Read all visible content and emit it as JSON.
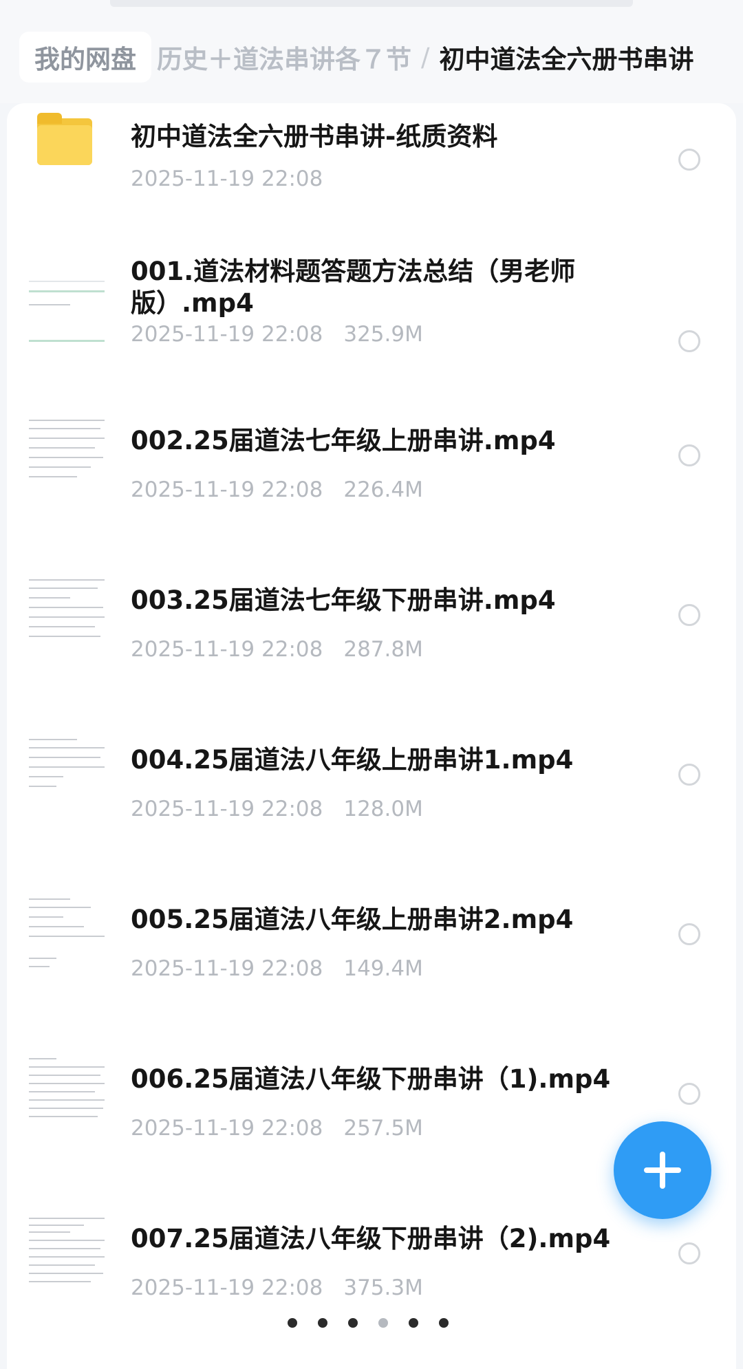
{
  "breadcrumb": {
    "root": "我的网盘",
    "parent": "历史＋道法串讲各７节",
    "separator": "/",
    "current": "初中道法全六册书串讲"
  },
  "items": [
    {
      "title": "初中道法全六册书串讲-纸质资料",
      "date": "2025-11-19 22:08",
      "size": "",
      "icon": "folder-icon"
    },
    {
      "title": "001.道法材料题答题方法总结（男老师版）.mp4",
      "date": "2025-11-19 22:08",
      "size": "325.9M",
      "icon": "video-thumbnail"
    },
    {
      "title": "002.25届道法七年级上册串讲.mp4",
      "date": "2025-11-19 22:08",
      "size": "226.4M",
      "icon": "video-thumbnail"
    },
    {
      "title": "003.25届道法七年级下册串讲.mp4",
      "date": "2025-11-19 22:08",
      "size": "287.8M",
      "icon": "video-thumbnail"
    },
    {
      "title": "004.25届道法八年级上册串讲1.mp4",
      "date": "2025-11-19 22:08",
      "size": "128.0M",
      "icon": "video-thumbnail"
    },
    {
      "title": "005.25届道法八年级上册串讲2.mp4",
      "date": "2025-11-19 22:08",
      "size": "149.4M",
      "icon": "video-thumbnail"
    },
    {
      "title": "006.25届道法八年级下册串讲（1).mp4",
      "date": "2025-11-19 22:08",
      "size": "257.5M",
      "icon": "video-thumbnail"
    },
    {
      "title": "007.25届道法八年级下册串讲（2).mp4",
      "date": "2025-11-19 22:08",
      "size": "375.3M",
      "icon": "video-thumbnail"
    }
  ],
  "fab": {
    "icon": "plus-icon",
    "color": "#2f9cf5"
  },
  "pager": {
    "count": 6,
    "active_index": 3
  }
}
